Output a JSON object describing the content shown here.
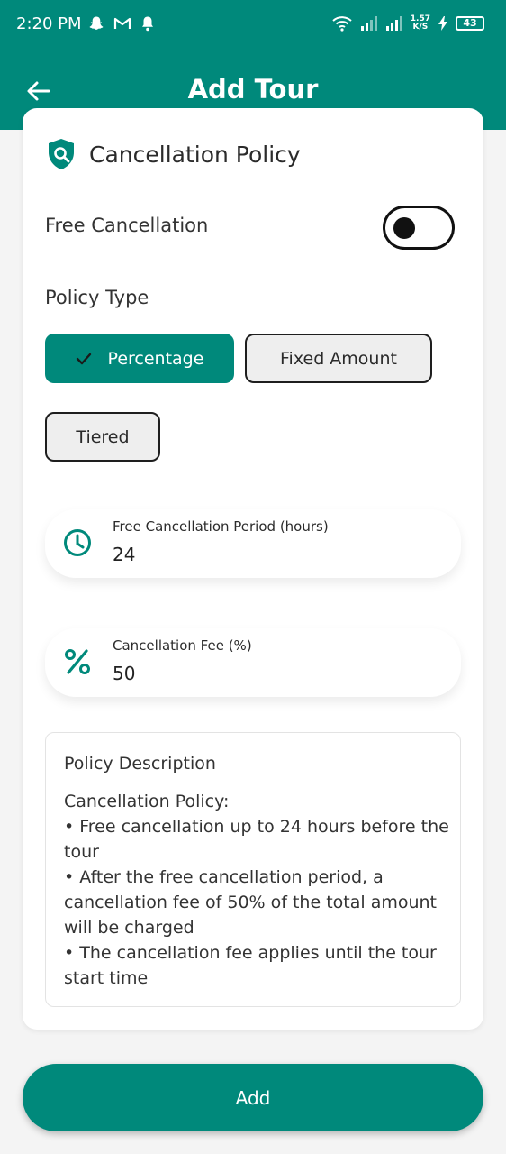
{
  "status_bar": {
    "time": "2:20 PM",
    "net_speed_value": "1.57",
    "net_speed_unit": "K/S",
    "battery": "43",
    "left_icons": [
      "snapchat-icon",
      "gmail-icon",
      "notification-bell-icon"
    ],
    "right_icons": [
      "wifi-icon",
      "signal-icon",
      "signal-icon",
      "charging-icon"
    ]
  },
  "app_bar": {
    "title": "Add Tour",
    "back_icon": "arrow-left-icon"
  },
  "colors": {
    "primary": "#00897b",
    "background": "#f4f4f4",
    "card": "#ffffff"
  },
  "section": {
    "title": "Cancellation Policy",
    "icon": "shield-search-icon"
  },
  "free_cancellation": {
    "label": "Free Cancellation",
    "enabled": false
  },
  "policy_type": {
    "label": "Policy Type",
    "options": [
      "Percentage",
      "Fixed Amount",
      "Tiered"
    ],
    "selected": "Percentage"
  },
  "fields": {
    "period": {
      "label": "Free Cancellation Period (hours)",
      "value": "24",
      "icon": "clock-icon"
    },
    "fee": {
      "label": "Cancellation Fee (%)",
      "value": "50",
      "icon": "percent-icon"
    }
  },
  "description": {
    "title": "Policy Description",
    "lines": [
      "Cancellation Policy:",
      "• Free cancellation up to 24 hours before the tour",
      "• After the free cancellation period, a cancellation fee of 50% of the total amount will be charged",
      "• The cancellation fee applies until the tour start time"
    ]
  },
  "actions": {
    "add_label": "Add"
  }
}
